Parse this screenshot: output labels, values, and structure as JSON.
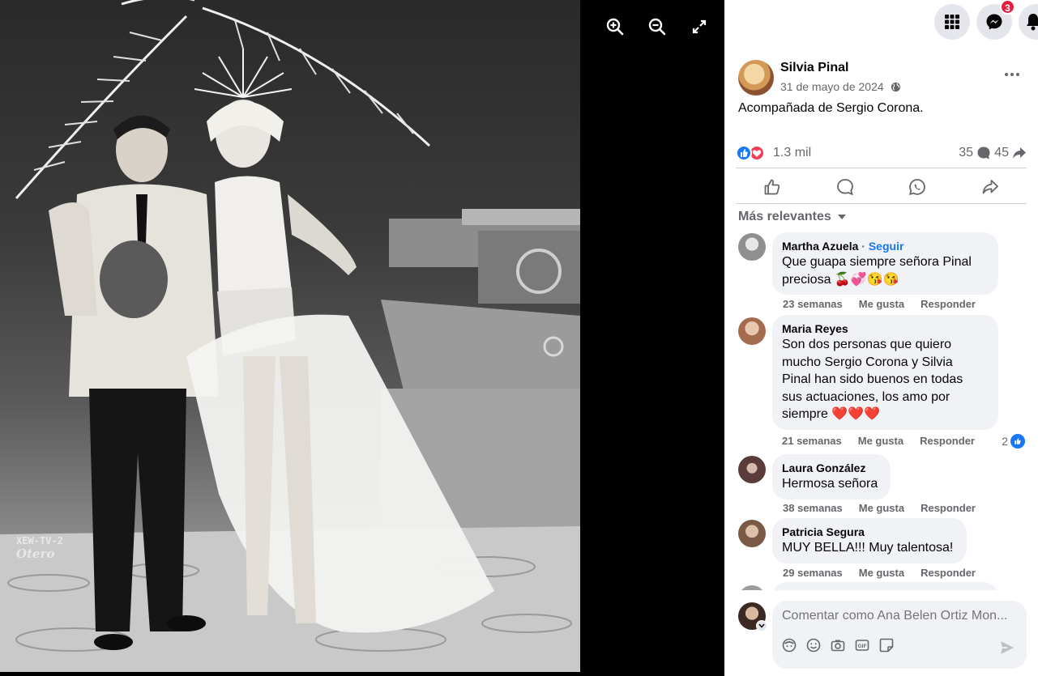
{
  "viewer": {
    "watermark_line1": "XEW-TV-2",
    "watermark_line2": "Otero",
    "tools": [
      "zoom-in",
      "zoom-out",
      "fullscreen"
    ]
  },
  "topbar": {
    "messenger_badge": "3"
  },
  "post": {
    "author": "Silvia Pinal",
    "date": "31 de mayo de 2024",
    "text": "Acompañada de Sergio Corona.",
    "reactions_count": "1.3 mil",
    "comments_count": "35",
    "shares_count": "45"
  },
  "sort_label": "Más relevantes",
  "comments": [
    {
      "name": "Martha Azuela",
      "follow": "Seguir",
      "text_lines": [
        "Que guapa siempre señora Pinal",
        "preciosa 🍒💞😘😘"
      ],
      "time": "23 semanas",
      "like": "Me gusta",
      "reply": "Responder",
      "avatar_color": "#c9c9c9"
    },
    {
      "name": "Maria Reyes",
      "text_lines": [
        "Son dos personas que quiero",
        "mucho Sergio Corona y Silvia",
        "Pinal han sido buenos en todas",
        "sus actuaciones, los amo por",
        "siempre ❤️❤️❤️"
      ],
      "time": "21 semanas",
      "like": "Me gusta",
      "reply": "Responder",
      "likes": "2",
      "avatar_color": "#b07a5a"
    },
    {
      "name": "Laura González",
      "text_lines": [
        "Hermosa señora"
      ],
      "time": "38 semanas",
      "like": "Me gusta",
      "reply": "Responder",
      "avatar_color": "#6b4b4b"
    },
    {
      "name": "Patricia Segura",
      "text_lines": [
        "MUY BELLA!!! Muy talentosa!"
      ],
      "time": "29 semanas",
      "like": "Me gusta",
      "reply": "Responder",
      "avatar_color": "#8a6d58"
    }
  ],
  "composer": {
    "placeholder": "Comentar como Ana Belen Ortiz Mon..."
  },
  "colors": {
    "accent": "#1877f2",
    "love": "#f33e58",
    "badge": "#e41e3f"
  }
}
